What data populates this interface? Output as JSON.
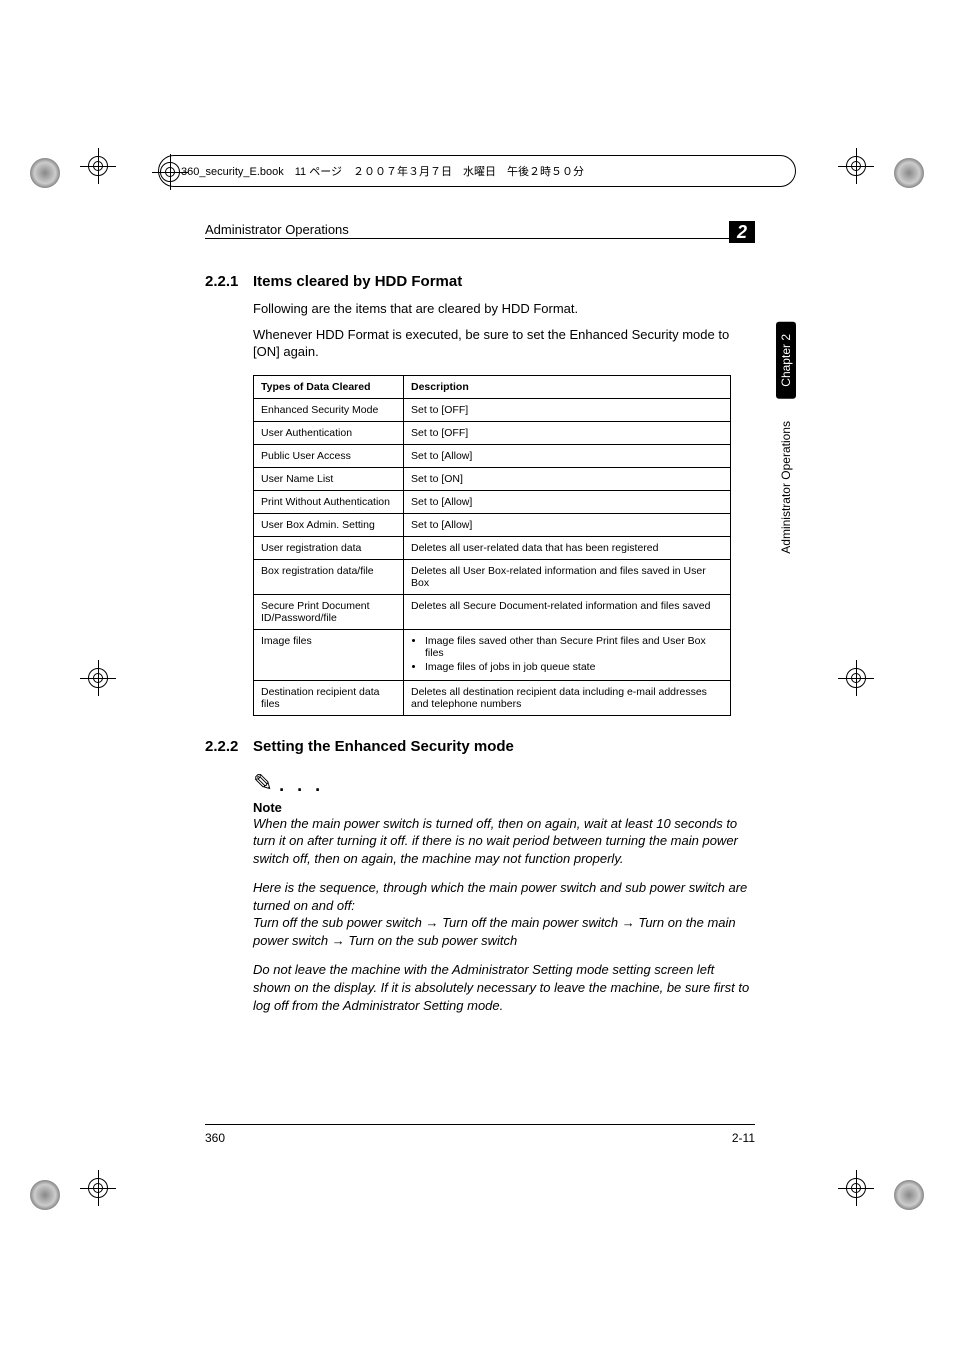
{
  "printers_bar": "360_security_E.book　11 ページ　２００７年３月７日　水曜日　午後２時５０分",
  "header": {
    "title": "Administrator Operations",
    "chapter_num": "2"
  },
  "section1": {
    "num": "2.2.1",
    "title": "Items cleared by HDD Format",
    "p1": "Following are the items that are cleared by HDD Format.",
    "p2": "Whenever HDD Format is executed, be sure to set the Enhanced Security mode to [ON] again."
  },
  "table": {
    "head": {
      "c1": "Types of Data Cleared",
      "c2": "Description"
    },
    "rows": [
      {
        "c1": "Enhanced Security Mode",
        "c2": "Set to [OFF]"
      },
      {
        "c1": "User Authentication",
        "c2": "Set to [OFF]"
      },
      {
        "c1": "Public User Access",
        "c2": "Set to [Allow]"
      },
      {
        "c1": "User Name List",
        "c2": "Set to [ON]"
      },
      {
        "c1": "Print Without Authentication",
        "c2": "Set to [Allow]"
      },
      {
        "c1": "User Box Admin. Setting",
        "c2": "Set to [Allow]"
      },
      {
        "c1": "User registration data",
        "c2": "Deletes all user-related data that has been registered"
      },
      {
        "c1": "Box registration data/file",
        "c2": "Deletes all User Box-related information and files saved in User Box"
      },
      {
        "c1": "Secure Print Document ID/Password/file",
        "c2": "Deletes all Secure Document-related information and files saved"
      },
      {
        "c1": "Image files",
        "bullets": [
          "Image files saved other than Secure Print files and User Box files",
          "Image files of jobs in job queue state"
        ]
      },
      {
        "c1": "Destination recipient data files",
        "c2": "Deletes all destination recipient data including e-mail addresses and telephone numbers"
      }
    ]
  },
  "section2": {
    "num": "2.2.2",
    "title": "Setting the Enhanced Security mode"
  },
  "note": {
    "label": "Note",
    "p1": "When the main power switch is turned off, then on again, wait at least 10 seconds to turn it on after turning it off. if there is no wait period between turning the main power switch off, then on again, the machine may not function properly.",
    "p2": "Here is the sequence, through which the main power switch and sub power switch are turned on and off:",
    "p3a": "Turn off the sub power switch ",
    "p3b": " Turn off the main power switch ",
    "p3c": " Turn on the main power switch ",
    "p3d": " Turn on the sub power switch",
    "p4": "Do not leave the machine with the Administrator Setting mode setting screen left shown on the display. If it is absolutely necessary to leave the machine, be sure first to log off from the Administrator Setting mode."
  },
  "side_tabs": {
    "chapter": "Chapter 2",
    "section": "Administrator Operations"
  },
  "footer": {
    "left": "360",
    "right": "2-11"
  }
}
